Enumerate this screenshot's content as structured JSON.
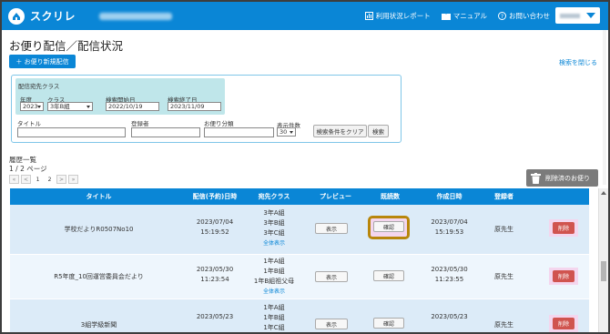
{
  "header": {
    "brand": "スクリレ",
    "nav": {
      "usage_report": "利用状況レポート",
      "manual": "マニュアル",
      "contact": "お問い合わせ"
    }
  },
  "page": {
    "title": "お便り配信／配信状況",
    "new_button": "＋ お便り新規配信",
    "close_search": "検索を閉じる"
  },
  "search": {
    "target_class_heading": "配信宛先クラス",
    "year_label": "年度",
    "year_value": "2023",
    "class_label": "クラス",
    "class_value": "3年B組",
    "start_label": "検索開始日",
    "start_value": "2022/10/19",
    "end_label": "検索終了日",
    "end_value": "2023/11/09",
    "title_label": "タイトル",
    "registrant_label": "登録者",
    "category_label": "お便り分類",
    "count_label": "表示件数",
    "count_value": "30",
    "clear_button": "検索条件をクリア",
    "search_button": "検索"
  },
  "history": {
    "heading": "履歴一覧",
    "page_info": "1 / 2 ページ",
    "pager": [
      "«",
      "<",
      "1",
      "2",
      ">",
      "»"
    ],
    "deleted_button": "削除済のお便り"
  },
  "table": {
    "headers": [
      "タイトル",
      "配信(予約)日時",
      "宛先クラス",
      "プレビュー",
      "既読数",
      "作成日時",
      "登録者",
      ""
    ],
    "rows": [
      {
        "title": "学校だよりR0507No10",
        "sent_date": "2023/07/04",
        "sent_time": "15:19:52",
        "classes": [
          "3年A組",
          "3年B組",
          "3年C組"
        ],
        "show_all": "全体表示",
        "preview": "表示",
        "read": "確認",
        "created_date": "2023/07/04",
        "created_time": "15:19:53",
        "registrant": "原先生",
        "delete": "削除"
      },
      {
        "title": "R5年度_10回運営委員会だより",
        "sent_date": "2023/05/30",
        "sent_time": "11:23:54",
        "classes": [
          "1年A組",
          "1年B組",
          "1年B組祖父母"
        ],
        "show_all": "全体表示",
        "preview": "表示",
        "read": "確認",
        "created_date": "2023/05/30",
        "created_time": "11:23:55",
        "registrant": "原先生",
        "delete": "削除"
      },
      {
        "title": "3組学級新聞",
        "sent_date": "2023/05/23",
        "sent_time": "",
        "classes": [
          "1年A組",
          "1年B組",
          "1年C組"
        ],
        "show_all": "",
        "preview": "表示",
        "read": "確認",
        "created_date": "2023/05/23",
        "created_time": "",
        "registrant": "原先生",
        "delete": "削除"
      }
    ]
  },
  "colors": {
    "primary": "#0a86d6",
    "highlight": "#b8860b",
    "delete": "#d0544f"
  }
}
